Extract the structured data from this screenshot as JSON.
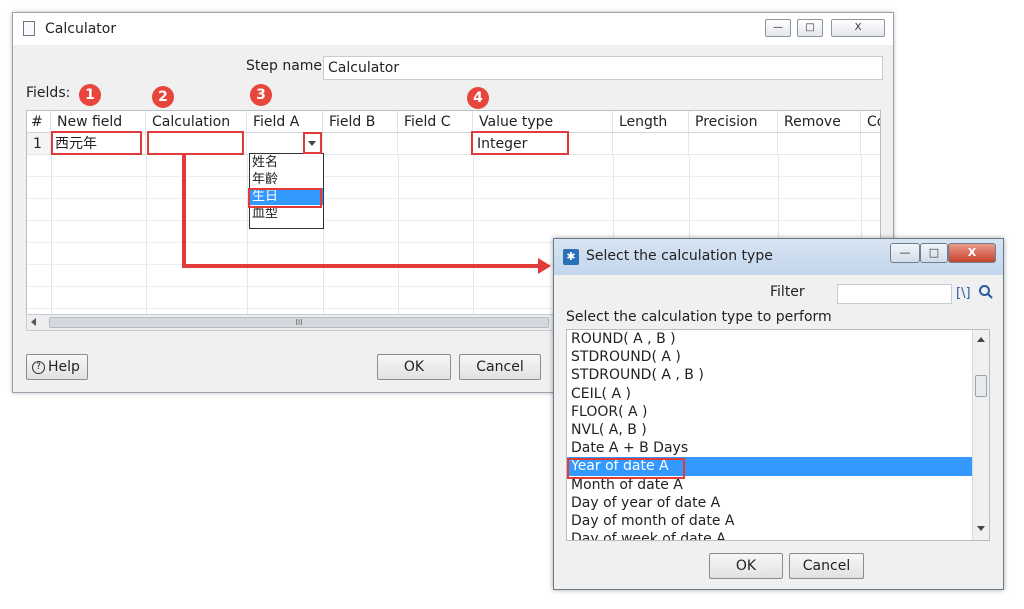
{
  "main_window": {
    "title": "Calculator",
    "controls": {
      "minimize": "—",
      "maximize": "□",
      "close": "X"
    },
    "step_name_label": "Step name",
    "step_name_value": "Calculator",
    "fields_label": "Fields:",
    "columns": [
      "#",
      "New field",
      "Calculation",
      "Field A",
      "Field B",
      "Field C",
      "Value type",
      "Length",
      "Precision",
      "Remove",
      "Co"
    ],
    "rows": [
      {
        "num": "1",
        "new_field": "西元年",
        "calculation": "",
        "field_a": "",
        "field_b": "",
        "field_c": "",
        "value_type": "Integer",
        "length": "",
        "precision": "",
        "remove": ""
      }
    ],
    "field_a_options": [
      "姓名",
      "年齡",
      "生日",
      "血型"
    ],
    "field_a_selected": "生日",
    "hscroll_grip": "III",
    "help_label": "Help",
    "ok_label": "OK",
    "cancel_label": "Cancel"
  },
  "badges": [
    "1",
    "2",
    "3",
    "4"
  ],
  "calc_dialog": {
    "title": "Select the calculation type",
    "controls": {
      "minimize": "—",
      "maximize": "□",
      "close": "X"
    },
    "filter_label": "Filter",
    "filter_value": "",
    "filter_icon_label": "[\\]",
    "instruction": "Select the calculation type to perform",
    "items": [
      "ROUND( A , B )",
      "STDROUND( A )",
      "STDROUND( A , B )",
      "CEIL( A )",
      "FLOOR( A )",
      "NVL( A, B )",
      "Date A + B Days",
      "Year of date A",
      "Month of date A",
      "Day of year of date A",
      "Day of month of date A",
      "Day of week of date A"
    ],
    "selected_item": "Year of date A",
    "ok_label": "OK",
    "cancel_label": "Cancel"
  },
  "colors": {
    "highlight": "#e03a3a",
    "selection": "#3399ff"
  }
}
